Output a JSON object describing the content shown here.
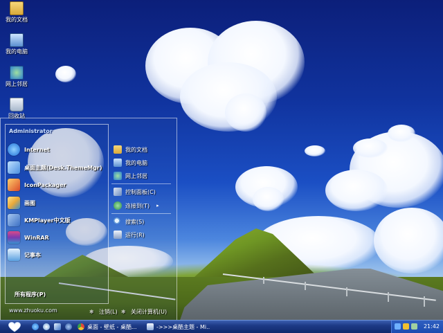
{
  "desktop": {
    "icons": [
      {
        "label": "我的文档",
        "icon": "folder-documents-icon"
      },
      {
        "label": "我的电脑",
        "icon": "my-computer-icon"
      },
      {
        "label": "网上邻居",
        "icon": "network-places-icon"
      },
      {
        "label": "回收站",
        "icon": "recycle-bin-icon"
      }
    ]
  },
  "start_menu": {
    "user_name": "Administrator",
    "programs": [
      {
        "label": "Internet",
        "icon": "internet-explorer-icon",
        "color": "#1e6fd9"
      },
      {
        "label": "桌面主题(Desk.ThemeMgr)",
        "icon": "theme-manager-icon",
        "color": "#4a8fe0"
      },
      {
        "label": "IconPackager",
        "icon": "iconpackager-icon",
        "color": "#d94a2a"
      },
      {
        "label": "画图",
        "icon": "paint-icon",
        "color": "#e8a93a"
      },
      {
        "label": "KMPlayer中文版",
        "icon": "kmplayer-icon",
        "color": "#3a6fc4"
      },
      {
        "label": "WinRAR",
        "icon": "winrar-icon",
        "color": "#7a3ab0"
      },
      {
        "label": "记事本",
        "icon": "notepad-icon",
        "color": "#5aa0e0"
      }
    ],
    "all_programs": "所有程序(P)",
    "places": [
      {
        "label": "我的文档",
        "icon": "folder-documents-icon"
      },
      {
        "label": "我的电脑",
        "icon": "my-computer-icon"
      },
      {
        "label": "网上邻居",
        "icon": "network-places-icon"
      }
    ],
    "system": [
      {
        "label": "控制面板(C)",
        "icon": "control-panel-icon"
      },
      {
        "label": "连接到(T)",
        "icon": "connect-to-icon"
      },
      {
        "label": "搜索(S)",
        "icon": "search-icon"
      },
      {
        "label": "运行(R)",
        "icon": "run-icon"
      }
    ],
    "watermark": "www.zhuoku.com",
    "logoff_label": "注销(L)",
    "shutdown_label": "关闭计算机(U)"
  },
  "taskbar": {
    "tasks": [
      {
        "label": "桌面 - 壁纸 - 桌酷...",
        "icon": "chrome-icon"
      },
      {
        "label": "->>>桌酷主题 - Mi...",
        "icon": "document-icon"
      }
    ],
    "clock": "21:42"
  },
  "colors": {
    "sky": "#10339e",
    "taskbar": "#1d3a86",
    "accent_user": "#cfe2ff"
  }
}
